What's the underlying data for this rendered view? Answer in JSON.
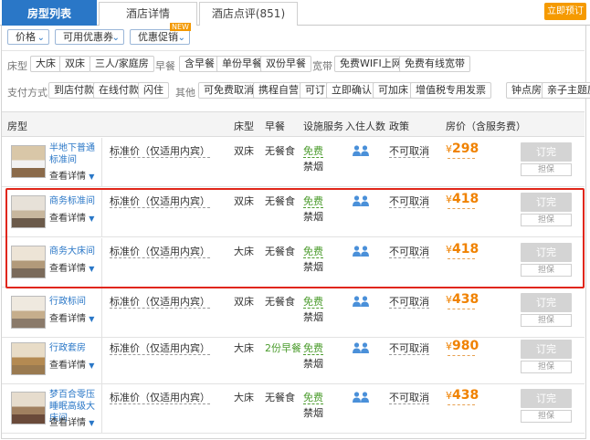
{
  "tabs": [
    {
      "label": "房型列表",
      "active": true
    },
    {
      "label": "酒店详情",
      "active": false
    },
    {
      "label": "酒店点评(851)",
      "active": false
    }
  ],
  "book_now": "立即预订",
  "dropdowns": [
    {
      "label": "价格"
    },
    {
      "label": "可用优惠券"
    },
    {
      "label": "优惠促销"
    }
  ],
  "new_tag": "NEW",
  "filters": {
    "bed_label": "床型",
    "bed_options": [
      "大床",
      "双床",
      "三人/家庭房"
    ],
    "breakfast_label": "早餐",
    "breakfast_options": [
      "含早餐",
      "单份早餐",
      "双份早餐"
    ],
    "broadband_label": "宽带",
    "broadband_options": [
      "免费WIFI上网",
      "免费有线宽带"
    ],
    "pay_label": "支付方式",
    "pay_options": [
      "到店付款",
      "在线付款",
      "闪住"
    ],
    "other_label": "其他",
    "other_options": [
      "可免费取消",
      "携程自营",
      "可订",
      "立即确认",
      "可加床",
      "增值税专用发票",
      "钟点房",
      "亲子主题房"
    ]
  },
  "table_header": {
    "room": "房型",
    "bed": "床型",
    "breakfast": "早餐",
    "facility": "设施服务",
    "persons": "入住人数",
    "policy": "政策",
    "price": "房价（含服务费）"
  },
  "rooms": [
    {
      "name": "半地下普通标准间",
      "details": "查看详情",
      "price_type": "标准价（仅适用内宾）",
      "bed": "双床",
      "breakfast": "无餐食",
      "breakfast_green": false,
      "wifi": "免费",
      "smoke": "禁烟",
      "policy": "不可取消",
      "price": "298",
      "currency": "¥",
      "status": "订完",
      "keep": "担保"
    },
    {
      "name": "商务标准间",
      "details": "查看详情",
      "price_type": "标准价（仅适用内宾）",
      "bed": "双床",
      "breakfast": "无餐食",
      "breakfast_green": false,
      "wifi": "免费",
      "smoke": "禁烟",
      "policy": "不可取消",
      "price": "418",
      "currency": "¥",
      "status": "订完",
      "keep": "担保"
    },
    {
      "name": "商务大床间",
      "details": "查看详情",
      "price_type": "标准价（仅适用内宾）",
      "bed": "大床",
      "breakfast": "无餐食",
      "breakfast_green": false,
      "wifi": "免费",
      "smoke": "禁烟",
      "policy": "不可取消",
      "price": "418",
      "currency": "¥",
      "status": "订完",
      "keep": "担保"
    },
    {
      "name": "行政标间",
      "details": "查看详情",
      "price_type": "标准价（仅适用内宾）",
      "bed": "双床",
      "breakfast": "无餐食",
      "breakfast_green": false,
      "wifi": "免费",
      "smoke": "禁烟",
      "policy": "不可取消",
      "price": "438",
      "currency": "¥",
      "status": "订完",
      "keep": "担保"
    },
    {
      "name": "行政套房",
      "details": "查看详情",
      "price_type": "标准价（仅适用内宾）",
      "bed": "大床",
      "breakfast": "2份早餐",
      "breakfast_green": true,
      "wifi": "免费",
      "smoke": "禁烟",
      "policy": "不可取消",
      "price": "980",
      "currency": "¥",
      "status": "订完",
      "keep": "担保"
    },
    {
      "name": "梦百合零压睡眠高级大床间",
      "details": "查看详情",
      "price_type": "标准价（仅适用内宾）",
      "bed": "大床",
      "breakfast": "无餐食",
      "breakfast_green": false,
      "wifi": "免费",
      "smoke": "禁烟",
      "policy": "不可取消",
      "price": "438",
      "currency": "¥",
      "status": "订完",
      "keep": "担保"
    }
  ],
  "colors": {
    "brand_blue": "#2a77c7",
    "orange": "#f08200",
    "green": "#4c9c2e",
    "highlight_red": "#e0261a"
  }
}
